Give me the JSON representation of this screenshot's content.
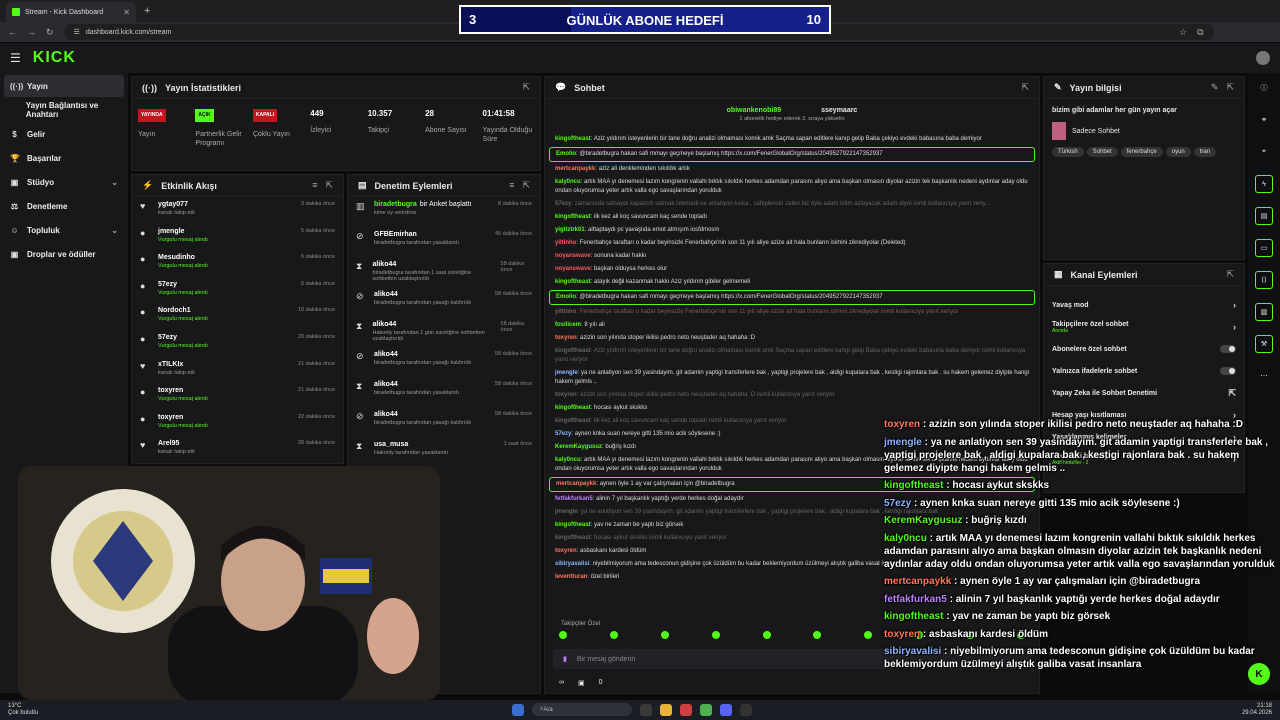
{
  "browser": {
    "tab_title": "Stream - Kick Dashboard",
    "url": "dashboard.kick.com/stream"
  },
  "goal": {
    "current": "3",
    "title": "GÜNLÜK ABONE HEDEFİ",
    "target": "10",
    "progress": 0.3
  },
  "brand": {
    "logo": "KICK"
  },
  "sidebar": {
    "items": [
      {
        "label": "Yayın",
        "icon": "broadcast-icon"
      },
      {
        "label": "Yayın Bağlantısı ve Anahtarı",
        "icon": ""
      },
      {
        "label": "Gelir",
        "icon": "money-icon"
      },
      {
        "label": "Başarılar",
        "icon": "trophy-icon"
      },
      {
        "label": "Stüdyo",
        "icon": "studio-icon"
      },
      {
        "label": "Denetleme",
        "icon": "gavel-icon"
      },
      {
        "label": "Topluluk",
        "icon": "community-icon"
      },
      {
        "label": "Droplar ve ödüller",
        "icon": "gift-icon"
      }
    ]
  },
  "stats_panel": {
    "title": "Yayın İstatistikleri",
    "items": [
      {
        "badge": "YAYINDA",
        "label": "Yayın",
        "kind": "red"
      },
      {
        "badge": "AÇIK",
        "label": "Partnerlik Gelir Programı",
        "kind": "green"
      },
      {
        "badge": "KAPALI",
        "label": "Çoklu Yayın",
        "kind": "red"
      },
      {
        "value": "449",
        "label": "İzleyici"
      },
      {
        "value": "10.357",
        "label": "Takipçi"
      },
      {
        "value": "28",
        "label": "Abone Sayısı"
      },
      {
        "value": "01:41:58",
        "label": "Yayında Olduğu Süre"
      }
    ]
  },
  "activity": {
    "title": "Etkinlik Akışı",
    "rows": [
      {
        "name": "ygtay077",
        "sub": "kanalı takip etti",
        "time": "3 dakika önce",
        "icon": "heart-icon",
        "green": false
      },
      {
        "name": "jmengle",
        "sub": "Vurgulu mesaj alındı",
        "time": "5 dakika önce",
        "icon": "coin-icon",
        "green": true
      },
      {
        "name": "Mesudinho",
        "sub": "Vurgulu mesaj alındı",
        "time": "6 dakika önce",
        "icon": "coin-icon",
        "green": true
      },
      {
        "name": "57ezy",
        "sub": "Vurgulu mesaj alındı",
        "time": "6 dakika önce",
        "icon": "coin-icon",
        "green": true
      },
      {
        "name": "Nordoch1",
        "sub": "Vurgulu mesaj alındı",
        "time": "10 dakika önce",
        "icon": "coin-icon",
        "green": true
      },
      {
        "name": "57ezy",
        "sub": "Vurgulu mesaj alındı",
        "time": "20 dakika önce",
        "icon": "coin-icon",
        "green": true
      },
      {
        "name": "xTILKIx",
        "sub": "kanalı takip etti",
        "time": "21 dakika önce",
        "icon": "heart-icon",
        "green": false
      },
      {
        "name": "toxyren",
        "sub": "Vurgulu mesaj alındı",
        "time": "21 dakika önce",
        "icon": "coin-icon",
        "green": true
      },
      {
        "name": "toxyren",
        "sub": "Vurgulu mesaj alındı",
        "time": "22 dakika önce",
        "icon": "coin-icon",
        "green": true
      },
      {
        "name": "Arel95",
        "sub": "kanalı takip etti",
        "time": "28 dakika önce",
        "icon": "heart-icon",
        "green": false
      }
    ]
  },
  "moderation": {
    "title": "Denetim Eylemleri",
    "rows": [
      {
        "name": "biradetbugra",
        "action": "bir Anket başlattı",
        "sub": "kime oy verirdiniz",
        "time": "8 dakika önce"
      },
      {
        "name": "GFBEmirhan",
        "action": "",
        "sub": "biradetbugra tarafından yasaklandı",
        "time": "45 dakika önce"
      },
      {
        "name": "aliko44",
        "action": "",
        "sub": "biradetbugra tarafından 1 saat süreliğine sohbetten uzaklaştırıldı",
        "time": "58 dakika önce"
      },
      {
        "name": "aliko44",
        "action": "",
        "sub": "biradetbugra tarafından yasağı kaldırıldı",
        "time": "58 dakika önce"
      },
      {
        "name": "aliko44",
        "action": "",
        "sub": "Hakonly tarafından 1 gün süreliğine sohbetten uzaklaştırıldı",
        "time": "58 dakika önce"
      },
      {
        "name": "aliko44",
        "action": "",
        "sub": "biradetbugra tarafından yasağı kaldırıldı",
        "time": "58 dakika önce"
      },
      {
        "name": "aliko44",
        "action": "",
        "sub": "biradetbugra tarafından yasaklandı",
        "time": "58 dakika önce"
      },
      {
        "name": "aliko44",
        "action": "",
        "sub": "biradetbugra tarafından yasağı kaldırıldı",
        "time": "58 dakika önce"
      },
      {
        "name": "usa_musa",
        "action": "",
        "sub": "Hakonly tarafından yasaklandı",
        "time": "1 saat önce"
      }
    ]
  },
  "chat": {
    "title": "Sohbet",
    "pinned": [
      {
        "name": "obiwankenobi89",
        "count": "1"
      },
      {
        "name": "sseymaarc",
        "count": "1"
      }
    ],
    "gift_note": "1 abonelik hediye ederek 3. sıraya yükselin",
    "lines": [
      {
        "u": "kingoftheast",
        "t": "Aziz yıldırım isteyenlerin bir tane doğru analizi olmaması komik amk Saçma sapan editlere kanıp gelip Baba çekiyo evdeki babasına baba demiyor",
        "c": "#53fc18",
        "box": false,
        "dim": false
      },
      {
        "u": "Emolio",
        "t": "@biradetbugra hakan safi mmayı geçmeye başlamış https://x.com/FenerGlobalOrg/status/2049527922147352937",
        "c": "#53fc18",
        "box": true,
        "dim": false
      },
      {
        "u": "mertcanpaykk",
        "t": "aziz ali denkleminden sıkıldık artık",
        "c": "#ff7a59",
        "box": false,
        "dim": false
      },
      {
        "u": "kaly0ncu",
        "t": "artık MAA yı denemesi lazım kongrenin vallahi bıktık sıkıldık herkes adamdan parasını alıyo ama başkan olmasın diyolar azizin tek başkanlık nedeni aydınlar aday oldu ondan oluyorumsa yeter artık valla ego savaşlarından yorulduk",
        "c": "#53fc18",
        "box": false,
        "dim": false
      },
      {
        "u": "57ezy",
        "t": "zamanında satsaydı kapatırdı satmak istemedi ne anlatıyon kıska , sahiplensin zaten biz öyle adam istim aşlayacak adam diyol isimli kullanıcıya yanıt veriy...",
        "c": "#666",
        "box": false,
        "dim": true
      },
      {
        "u": "kingoftheast",
        "t": "ilk kez ali koç savuncam kaç sende topladı",
        "c": "#53fc18",
        "box": false,
        "dim": false
      },
      {
        "u": "yigitztrk01",
        "t": "alttaptaydı pc yavaşlıda emot atmışım iosfdmosm",
        "c": "#53fc18",
        "box": false,
        "dim": false
      },
      {
        "u": "yiltinho",
        "t": "Fenerbahçe taraftarı o kadar beyinsizki Fenerbahçe'nin son 11 yılı aliye azize ait hala bunların isimini zikrediyolar (Deleted)",
        "c": "#ff5a5a",
        "box": false,
        "dim": false
      },
      {
        "u": "noyanswave",
        "t": "sonuna kadar hakkı",
        "c": "#ff5a5a",
        "box": false,
        "dim": false
      },
      {
        "u": "noyanswave",
        "t": "başkan olduysa herkes olur",
        "c": "#ff5a5a",
        "box": false,
        "dim": false
      },
      {
        "u": "kingoftheast",
        "t": "atayık değil kazanmak hakkı Aziz yıldırım gibiler gelmemeli",
        "c": "#53fc18",
        "box": false,
        "dim": false
      },
      {
        "u": "Emolio",
        "t": "@biradetbugra hakan safi mmayı geçmeye başlamış https://x.com/FenerGlobalOrg/status/2049527922147352937",
        "c": "#53fc18",
        "box": true,
        "dim": false
      },
      {
        "u": "yiltinho",
        "t": "Fenerbahçe taraftarı o kadar beyinsizki Fenerbahçe'nin son 11 yılı aliye azize ait hala bunların isimini zikrediyolar isimli kullanıcıya yanıt veriyor",
        "c": "#666",
        "box": false,
        "dim": true
      },
      {
        "u": "fosilicem",
        "t": "8 yılı ali",
        "c": "#53fc18",
        "box": false,
        "dim": false
      },
      {
        "u": "toxyren",
        "t": "azizin son yılında stoper ikilisi pedro neto neuştader aq hahaha :D",
        "c": "#ff7a59",
        "box": false,
        "dim": false
      },
      {
        "u": "kingoftheast",
        "t": "Aziz yıldırım isteyenlerin bir tane doğru analizi olmaması komik amk Saçma sapan editlere kanıp gelip Baba çekiyo evdeki babasına baba deniyor isimli kullanıcıya yanıt veriyor",
        "c": "#666",
        "box": false,
        "dim": true
      },
      {
        "u": "jmengle",
        "t": "ya ne anlatiyon sen 39 yasindayim. git adamin yaptigi transferlere bak , yaptigi projelere bak , aldigi kupalara bak , kestigi rajonlara bak . su hakem gelemez diyipte hangi hakem gelmis ..",
        "c": "#8fb5ff",
        "box": false,
        "dim": false
      },
      {
        "u": "toxyren",
        "t": "azizin son yılında stoper ikilisi pedro neto neuştader aq hahaha :D isimli kullanıcıya yanıt veriyor",
        "c": "#666",
        "box": false,
        "dim": true
      },
      {
        "u": "kingoftheast",
        "t": "hocası aykut skskks",
        "c": "#53fc18",
        "box": false,
        "dim": false
      },
      {
        "u": "kingoftheast",
        "t": "ilk kez ali koç savuncam kaç sende topladı isimli kullanıcıya yanıt veriyor",
        "c": "#666",
        "box": false,
        "dim": true
      },
      {
        "u": "57ezy",
        "t": "aynen knka suan nereye gitti 135 mio acik söylesene :)",
        "c": "#8fb5ff",
        "box": false,
        "dim": false
      },
      {
        "u": "KeremKaygusuz",
        "t": "buğriş kızdı",
        "c": "#53fc18",
        "box": false,
        "dim": false
      },
      {
        "u": "kaly0ncu",
        "t": "artık MAA yı denemesi lazım kongrenin vallahi bıktık sıkıldık herkes adamdan parasını alıyo ama başkan olmasın diyolar azizin tek başkanlık nedeni aydınlar aday oldu ondan oluyorumsa yeter artık valla ego savaşlarından yorulduk",
        "c": "#53fc18",
        "box": false,
        "dim": false
      },
      {
        "u": "mertcanpaykk",
        "t": "aynen öyle 1 ay var çalışmaları için @biradetbugra",
        "c": "#ff7a59",
        "box": true,
        "dim": false
      },
      {
        "u": "fetfakfurkan5",
        "t": "alinin 7 yıl başkanlık yaptığı yerde herkes doğal adaydır",
        "c": "#c080ff",
        "box": false,
        "dim": false
      },
      {
        "u": "jmengle",
        "t": "ya ne anlatiyon sen 39 yasindayim. git adamin yaptigi transferlere bak , yaptigi projelere bak , aldigi kupalara bak , kestigi rajonlara bak",
        "c": "#666",
        "box": false,
        "dim": true
      },
      {
        "u": "kingoftheast",
        "t": "yav ne zaman be yaptı biz görsek",
        "c": "#53fc18",
        "box": false,
        "dim": false
      },
      {
        "u": "kingoftheast",
        "t": "hocası aykut skskks isimli kullanıcıya yanıt veriyor",
        "c": "#666",
        "box": false,
        "dim": true
      },
      {
        "u": "toxyren",
        "t": "asbaskanı kardesi öldüm",
        "c": "#ff7a59",
        "box": false,
        "dim": false
      },
      {
        "u": "sibiryavalisi",
        "t": "niyebilmiyorum ama tedesconun gidişine çok üzüldüm bu kadar beklemiyordum üzülmeyi alıştık galiba vasat insanlara",
        "c": "#8fb5ff",
        "box": false,
        "dim": false
      },
      {
        "u": "leventturan",
        "t": "özel birileri",
        "c": "#ff7a59",
        "box": false,
        "dim": false
      }
    ],
    "follower_only": "Takipçiler Özel",
    "input_placeholder": "Bir mesaj gönderin",
    "footer_count": "0"
  },
  "stream_info": {
    "title": "Yayın bilgisi",
    "stream_title": "bizim gibi adamlar her gün yayın açar",
    "category": "Sadece Sohbet",
    "tags": [
      "Türkish",
      "Sohbet",
      "fenerbahçe",
      "oyun",
      "tran"
    ]
  },
  "channel_actions": {
    "title": "Kanal Eylemleri",
    "rows": [
      {
        "label": "Yavaş mod",
        "sub": "",
        "ctl": "chevron"
      },
      {
        "label": "Takipçilere özel sohbet",
        "sub": "Anında",
        "ctl": "chevron"
      },
      {
        "label": "Abonelere özel sohbet",
        "sub": "",
        "ctl": "toggle"
      },
      {
        "label": "Yalnızca ifadelerle sohbet",
        "sub": "",
        "ctl": "toggle"
      },
      {
        "label": "Yapay Zeka ile Sohbet Denetimi",
        "sub": "",
        "ctl": "external"
      },
      {
        "label": "Hesap yaşı kısıtlaması",
        "sub": "",
        "ctl": "chevron"
      },
      {
        "label": "Yasaklanmış kelimeler",
        "sub": "",
        "ctl": "chevron"
      },
      {
        "label": "Hedefleri belirleyin",
        "sub": "Aktif hedefler - 2",
        "ctl": "chevron"
      }
    ]
  },
  "overlay_chat": [
    {
      "u": "toxyren",
      "t": "azizin son yılında stoper ikilisi pedro neto neuştader aq hahaha :D",
      "c": "#ff7a59"
    },
    {
      "u": "jmengle",
      "t": "ya ne anlatiyon sen 39 yasindayim. git adamin yaptigi transferlere bak , yaptigi projelere bak , aldigi kupalara bak , kestigi rajonlara bak . su hakem gelemez diyipte hangi hakem gelmis ..",
      "c": "#8fb5ff"
    },
    {
      "u": "kingoftheast",
      "t": "hocası aykut skskks",
      "c": "#53fc18"
    },
    {
      "u": "57ezy",
      "t": "aynen knka suan nereye gitti 135 mio acik söylesene :)",
      "c": "#8fb5ff"
    },
    {
      "u": "KeremKaygusuz",
      "t": "buğriş kızdı",
      "c": "#53fc18"
    },
    {
      "u": "kaly0ncu",
      "t": "artık MAA yı denemesi lazım kongrenin vallahi bıktık sıkıldık herkes adamdan parasını alıyo ama başkan olmasın diyolar azizin tek başkanlık nedeni aydınlar aday oldu ondan oluyorumsa yeter artık valla ego savaşlarından yorulduk",
      "c": "#53fc18"
    },
    {
      "u": "mertcanpaykk",
      "t": "aynen öyle 1 ay var çalışmaları için @biradetbugra",
      "c": "#ff7a59"
    },
    {
      "u": "fetfakfurkan5",
      "t": "alinin 7 yıl başkanlık yaptığı yerde herkes doğal adaydır",
      "c": "#c080ff"
    },
    {
      "u": "kingoftheast",
      "t": "yav ne zaman be yaptı biz görsek",
      "c": "#53fc18"
    },
    {
      "u": "toxyren",
      "t": "asbaskanı kardesi öldüm",
      "c": "#ff7a59"
    },
    {
      "u": "sibiryavalisi",
      "t": "niyebilmiyorum ama tedesconun gidişine çok üzüldüm bu kadar beklemiyordum üzülmeyi alıştık galiba vasat insanlara",
      "c": "#8fb5ff"
    }
  ],
  "taskbar": {
    "weather_temp": "13°C",
    "weather_desc": "Çok bulutlu",
    "search": "Ara",
    "time": "21:18",
    "date": "29.04.2026"
  }
}
